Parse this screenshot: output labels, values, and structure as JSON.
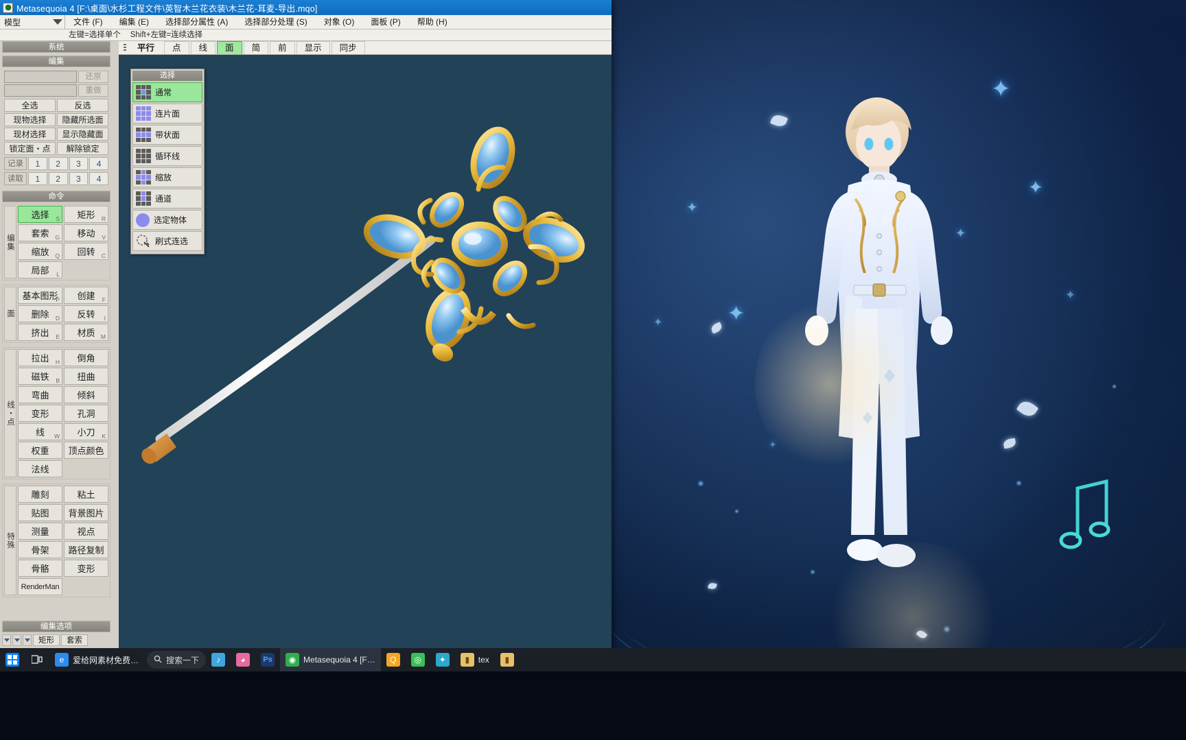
{
  "window": {
    "title": "Metasequoia 4 [F:\\桌面\\水杉工程文件\\英智木兰花衣装\\木兰花-耳麦-导出.mqo]",
    "mode_selector": "模型",
    "hint_left": "左键=选择单个",
    "hint_right": "Shift+左键=连续选择"
  },
  "menubar": [
    {
      "label": "文件 (F)"
    },
    {
      "label": "编集 (E)"
    },
    {
      "label": "选择部分属性 (A)"
    },
    {
      "label": "选择部分处理 (S)"
    },
    {
      "label": "对象 (O)"
    },
    {
      "label": "面板 (P)"
    },
    {
      "label": "帮助 (H)"
    }
  ],
  "view_tabs": [
    {
      "label": "平行",
      "state": "bold"
    },
    {
      "label": "点",
      "state": "normal"
    },
    {
      "label": "线",
      "state": "normal"
    },
    {
      "label": "面",
      "state": "selected"
    },
    {
      "label": "简",
      "state": "normal"
    },
    {
      "label": "前",
      "state": "normal"
    },
    {
      "label": "显示",
      "state": "normal"
    },
    {
      "label": "同步",
      "state": "normal"
    }
  ],
  "panels": {
    "system": {
      "header": "系统"
    },
    "edit": {
      "header": "编集",
      "undo_label": "还原",
      "redo_label": "重做",
      "buttons": [
        "全选",
        "反选",
        "现物选择",
        "隐藏所选面",
        "现材选择",
        "显示隐藏面",
        "锁定面・点",
        "解除锁定"
      ],
      "record_label": "记录",
      "load_label": "读取",
      "slots": [
        "1",
        "2",
        "3",
        "4"
      ]
    },
    "command": {
      "header": "命令",
      "groups": [
        {
          "side_label": "编集",
          "buttons": [
            {
              "label": "选择",
              "hotkey": "S",
              "active": true
            },
            {
              "label": "矩形",
              "hotkey": "R",
              "active": false
            },
            {
              "label": "套索",
              "hotkey": "G",
              "active": false
            },
            {
              "label": "移动",
              "hotkey": "V",
              "active": false
            },
            {
              "label": "缩放",
              "hotkey": "Q",
              "active": false
            },
            {
              "label": "回转",
              "hotkey": "C",
              "active": false
            },
            {
              "label": "局部",
              "hotkey": "L",
              "active": false
            },
            {
              "label": "",
              "hotkey": "",
              "active": false
            }
          ]
        },
        {
          "side_label": "面",
          "buttons": [
            {
              "label": "基本图形",
              "hotkey": "P",
              "active": false
            },
            {
              "label": "创建",
              "hotkey": "F",
              "active": false
            },
            {
              "label": "删除",
              "hotkey": "D",
              "active": false
            },
            {
              "label": "反转",
              "hotkey": "I",
              "active": false
            },
            {
              "label": "挤出",
              "hotkey": "E",
              "active": false
            },
            {
              "label": "材质",
              "hotkey": "M",
              "active": false
            }
          ]
        },
        {
          "side_label": "线・点",
          "buttons": [
            {
              "label": "拉出",
              "hotkey": "H",
              "active": false
            },
            {
              "label": "倒角",
              "hotkey": "",
              "active": false
            },
            {
              "label": "磁铁",
              "hotkey": "B",
              "active": false
            },
            {
              "label": "扭曲",
              "hotkey": "",
              "active": false
            },
            {
              "label": "弯曲",
              "hotkey": "",
              "active": false
            },
            {
              "label": "倾斜",
              "hotkey": "",
              "active": false
            },
            {
              "label": "变形",
              "hotkey": "",
              "active": false
            },
            {
              "label": "孔洞",
              "hotkey": "",
              "active": false
            },
            {
              "label": "线",
              "hotkey": "W",
              "active": false
            },
            {
              "label": "小刀",
              "hotkey": "K",
              "active": false
            },
            {
              "label": "权重",
              "hotkey": "",
              "active": false
            },
            {
              "label": "顶点颜色",
              "hotkey": "",
              "active": false
            },
            {
              "label": "法线",
              "hotkey": "",
              "active": false
            },
            {
              "label": "",
              "hotkey": "",
              "active": false
            }
          ]
        },
        {
          "side_label": "特殊",
          "buttons": [
            {
              "label": "雕刻",
              "hotkey": "",
              "active": false
            },
            {
              "label": "粘土",
              "hotkey": "",
              "active": false
            },
            {
              "label": "贴图",
              "hotkey": "",
              "active": false
            },
            {
              "label": "背景图片",
              "hotkey": "",
              "active": false
            },
            {
              "label": "测量",
              "hotkey": "",
              "active": false
            },
            {
              "label": "视点",
              "hotkey": "",
              "active": false
            },
            {
              "label": "骨架",
              "hotkey": "",
              "active": false
            },
            {
              "label": "路径复制",
              "hotkey": "",
              "active": false
            },
            {
              "label": "骨骼",
              "hotkey": "",
              "active": false
            },
            {
              "label": "变形",
              "hotkey": "",
              "active": false
            },
            {
              "label": "RenderMan",
              "hotkey": "",
              "active": false
            },
            {
              "label": "",
              "hotkey": "",
              "active": false
            }
          ]
        }
      ]
    },
    "edit_options": {
      "header": "编集选项",
      "buttons": [
        "矩形",
        "套索"
      ]
    }
  },
  "select_palette": {
    "header": "选择",
    "items": [
      {
        "label": "通常",
        "icon": "grid-center-icon",
        "active": true
      },
      {
        "label": "连片面",
        "icon": "grid-full-icon",
        "active": false
      },
      {
        "label": "带状面",
        "icon": "grid-band-icon",
        "active": false
      },
      {
        "label": "循环线",
        "icon": "grid-loop-icon",
        "active": false
      },
      {
        "label": "缩放",
        "icon": "grid-scale-icon",
        "active": false
      },
      {
        "label": "通道",
        "icon": "grid-path-icon",
        "active": false
      },
      {
        "label": "选定物体",
        "icon": "sphere-select-icon",
        "active": false
      },
      {
        "label": "刷式连选",
        "icon": "brush-select-icon",
        "active": false
      }
    ]
  },
  "taskbar": {
    "start_label": "",
    "search_placeholder": "搜索一下",
    "items": [
      {
        "label": "",
        "icon": "start-icon",
        "color": "#0a84ff",
        "active": false
      },
      {
        "label": "",
        "icon": "task-view-icon",
        "color": "#d8d8d8",
        "active": false
      },
      {
        "label": "爱给网素材免费…",
        "icon": "edge-icon",
        "color": "#2d8cf0",
        "active": false
      },
      {
        "label": "搜索一下",
        "icon": "search-pill-icon",
        "color": "#2a2f38",
        "active": false
      },
      {
        "label": "",
        "icon": "music-icon",
        "color": "#3ea7e0",
        "active": false
      },
      {
        "label": "",
        "icon": "palette-icon",
        "color": "#e86aa0",
        "active": false
      },
      {
        "label": "Ps",
        "icon": "photoshop-icon",
        "color": "#2d6fb8",
        "active": false
      },
      {
        "label": "Metasequoia 4 [F…",
        "icon": "mqo-icon",
        "color": "#2fae4e",
        "active": true
      },
      {
        "label": "",
        "icon": "qq-icon",
        "color": "#f5a623",
        "active": false
      },
      {
        "label": "",
        "icon": "browser-icon",
        "color": "#3bbf5a",
        "active": false
      },
      {
        "label": "",
        "icon": "blender-icon",
        "color": "#2aa9c9",
        "active": false
      },
      {
        "label": "tex",
        "icon": "folder-icon",
        "color": "#e8c06a",
        "active": false
      },
      {
        "label": "",
        "icon": "folder2-icon",
        "color": "#e8c06a",
        "active": false
      }
    ]
  },
  "colors": {
    "accent": "#1b7fd4",
    "selection_green": "#98e79a",
    "viewport_bg": "#214257",
    "panel_bg": "#d4d0c8"
  }
}
